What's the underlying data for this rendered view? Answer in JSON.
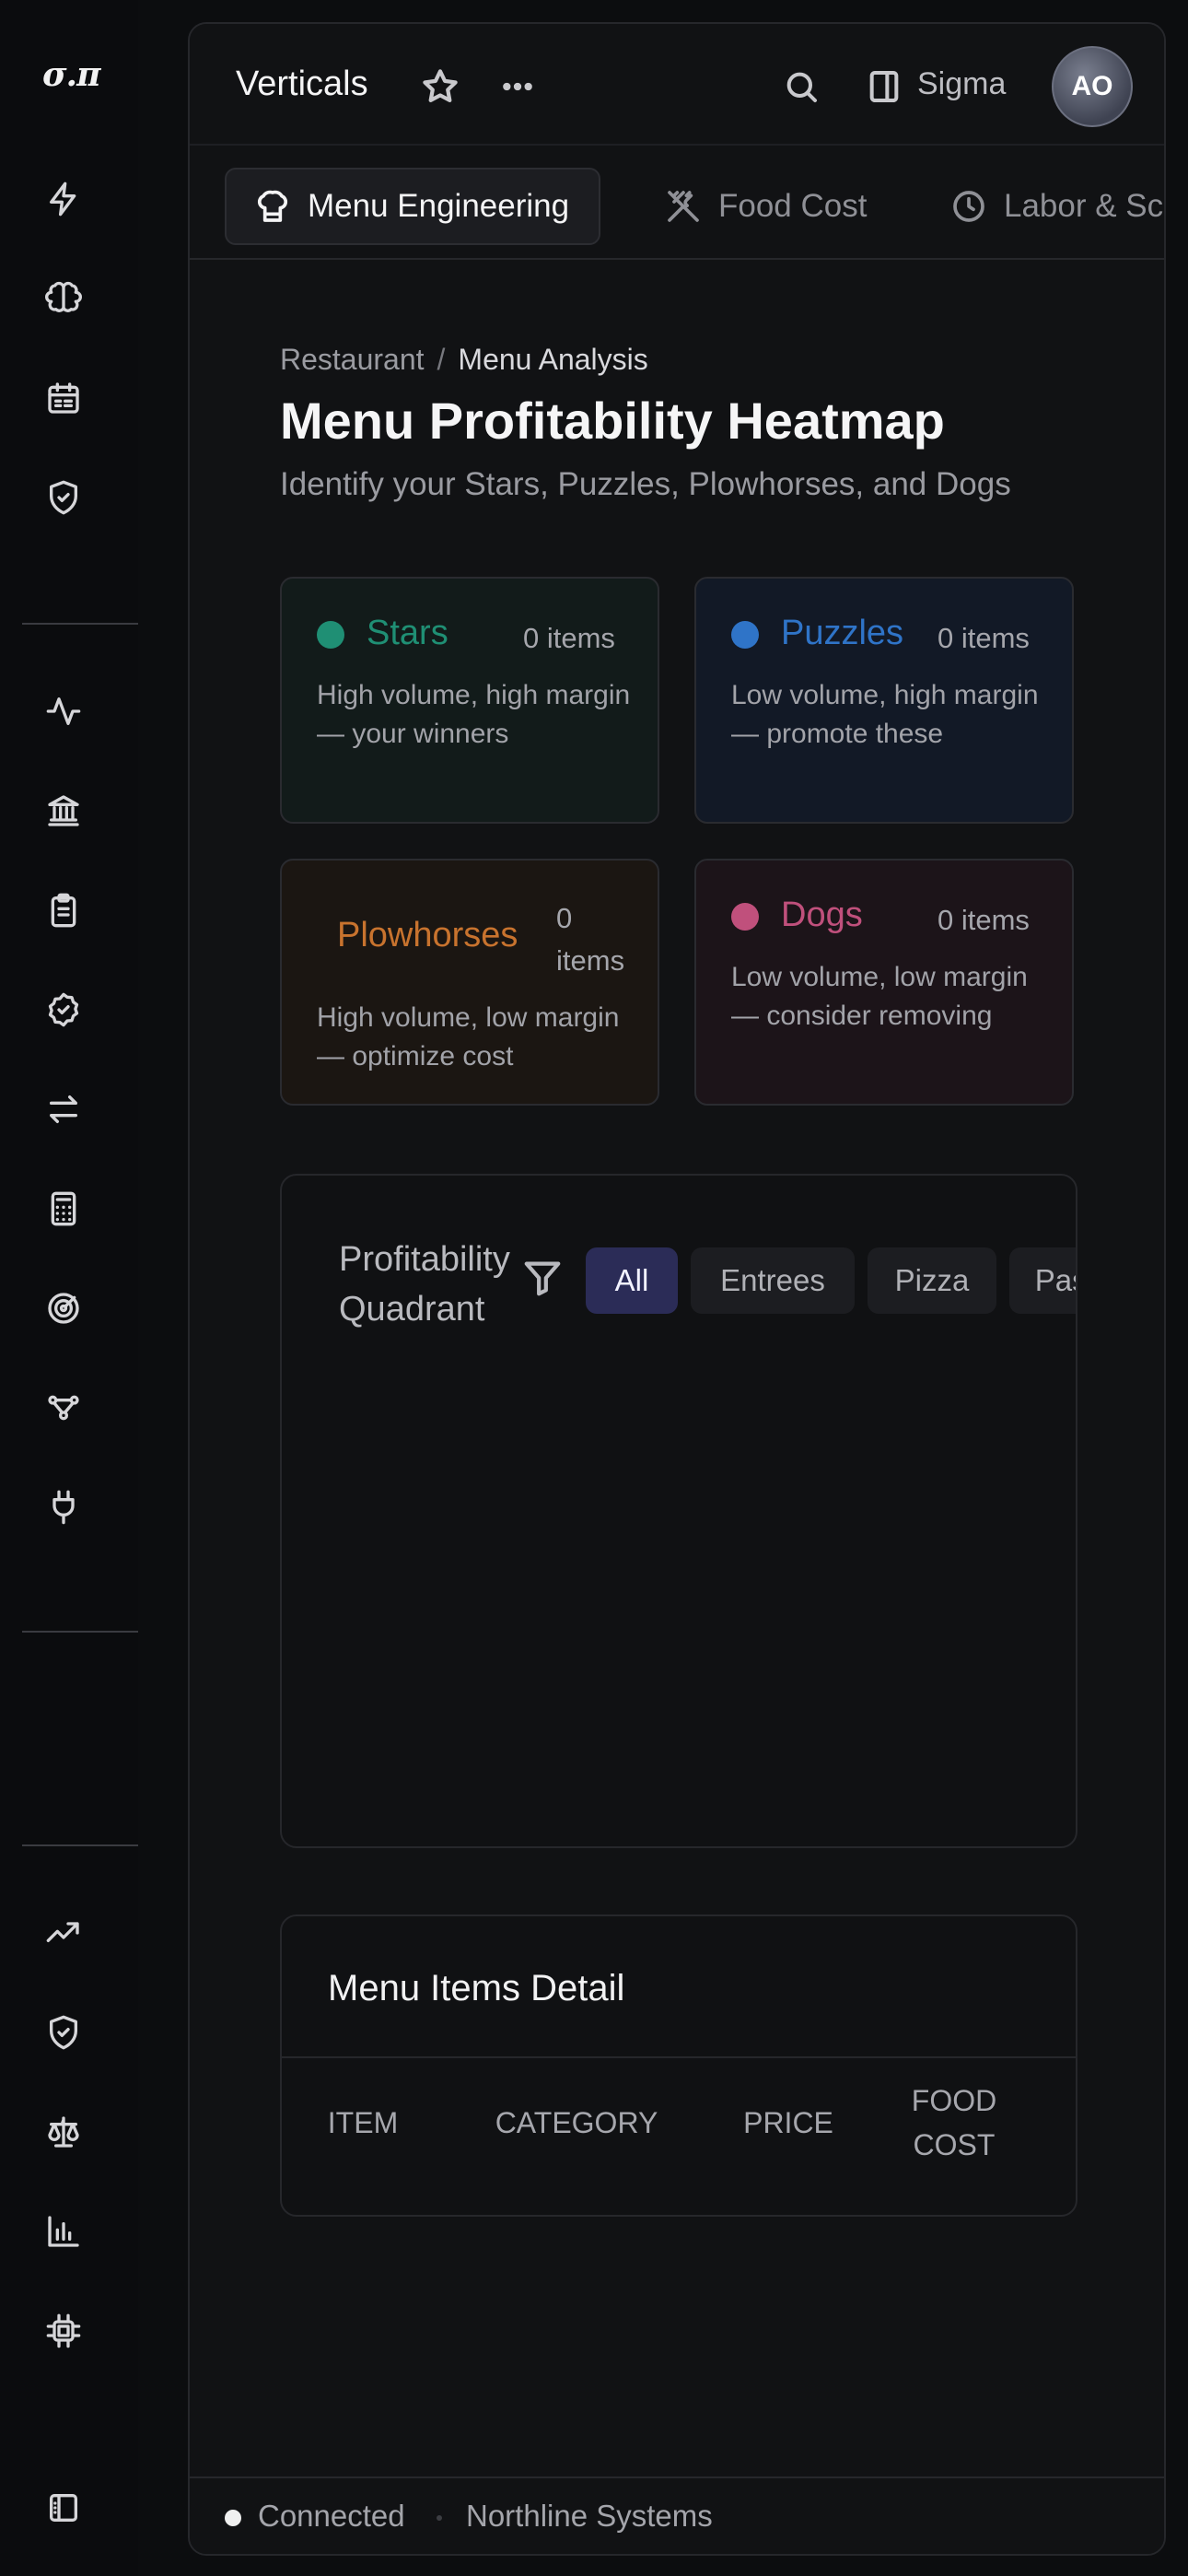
{
  "rail": {
    "logo": "σ.π",
    "icons": [
      "lightning-icon",
      "brain-icon",
      "calendar-icon",
      "shield-check-icon",
      "activity-icon",
      "bank-icon",
      "clipboard-icon",
      "badge-check-icon",
      "arrows-left-right-icon",
      "calculator-icon",
      "target-icon",
      "workflow-icon",
      "plug-icon",
      "trending-up-icon",
      "shield-check-icon",
      "scale-icon",
      "bar-chart-icon",
      "cpu-icon",
      "panel-icon"
    ]
  },
  "topbar": {
    "title": "Verticals",
    "sigma_label": "Sigma",
    "avatar_initials": "AO"
  },
  "tabs": [
    {
      "label": "Menu Engineering",
      "icon": "chef-hat-icon",
      "active": true
    },
    {
      "label": "Food Cost",
      "icon": "utensils-crossed-icon",
      "active": false
    },
    {
      "label": "Labor & Sc",
      "icon": "clock-icon",
      "active": false
    }
  ],
  "breadcrumb": {
    "parent": "Restaurant",
    "separator": "/",
    "current": "Menu Analysis"
  },
  "page": {
    "title": "Menu Profitability Heatmap",
    "subtitle": "Identify your Stars, Puzzles, Plowhorses, and Dogs"
  },
  "quadrants": [
    {
      "name": "Stars",
      "count": "0 items",
      "description": "High volume, high margin — your winners",
      "color": "#1f8f74",
      "bg": "#121b1a"
    },
    {
      "name": "Puzzles",
      "count": "0 items",
      "description": "Low volume, high margin — promote these",
      "color": "#2f74c8",
      "bg": "#121926"
    },
    {
      "name": "Plowhorses",
      "count_line1": "0",
      "count_line2": "items",
      "description": "High volume, low margin — optimize cost",
      "color": "#c8732e",
      "bg": "#1b1612"
    },
    {
      "name": "Dogs",
      "count": "0 items",
      "description": "Low volume, low margin — consider removing",
      "color": "#c0507c",
      "bg": "#1c1419"
    }
  ],
  "chart_panel": {
    "title": "Profitability Quadrant",
    "filters": [
      {
        "label": "All",
        "active": true
      },
      {
        "label": "Entrees",
        "active": false
      },
      {
        "label": "Pizza",
        "active": false
      },
      {
        "label": "Pasta",
        "active": false
      }
    ]
  },
  "table": {
    "title": "Menu Items Detail",
    "columns": [
      "ITEM",
      "CATEGORY",
      "PRICE",
      "FOOD COST"
    ]
  },
  "status": {
    "connection": "Connected",
    "organization": "Northline Systems"
  }
}
